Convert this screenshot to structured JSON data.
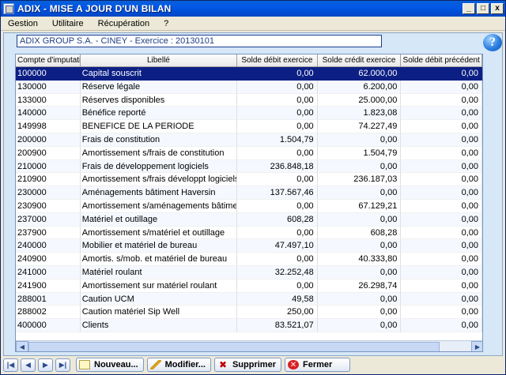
{
  "window": {
    "title": "ADIX - MISE A JOUR D'UN BILAN",
    "minimize": "_",
    "maximize": "□",
    "close": "x"
  },
  "menu": {
    "items": [
      {
        "label": "Gestion"
      },
      {
        "label": "Utilitaire"
      },
      {
        "label": "Récupération"
      },
      {
        "label": "?"
      }
    ]
  },
  "company": {
    "info": "ADIX GROUP S.A.   - CINEY - Exercice : 20130101"
  },
  "help": {
    "glyph": "?"
  },
  "table": {
    "columns": [
      "Compte d'imputation",
      "Libellé",
      "Solde débit exercice",
      "Solde crédit exercice",
      "Solde débit précédent"
    ],
    "rows": [
      [
        "100000",
        "Capital souscrit",
        "0,00",
        "62.000,00",
        "0,00"
      ],
      [
        "130000",
        "Réserve légale",
        "0,00",
        "6.200,00",
        "0,00"
      ],
      [
        "133000",
        "Réserves disponibles",
        "0,00",
        "25.000,00",
        "0,00"
      ],
      [
        "140000",
        "Bénéfice reporté",
        "0,00",
        "1.823,08",
        "0,00"
      ],
      [
        "149998",
        "BENEFICE DE LA PERIODE",
        "0,00",
        "74.227,49",
        "0,00"
      ],
      [
        "200000",
        "Frais de constitution",
        "1.504,79",
        "0,00",
        "0,00"
      ],
      [
        "200900",
        "Amortissement s/frais de constitution",
        "0,00",
        "1.504,79",
        "0,00"
      ],
      [
        "210000",
        "Frais de développement logiciels",
        "236.848,18",
        "0,00",
        "0,00"
      ],
      [
        "210900",
        "Amortissement s/frais développt logiciels",
        "0,00",
        "236.187,03",
        "0,00"
      ],
      [
        "230000",
        "Aménagements bâtiment Haversin",
        "137.567,46",
        "0,00",
        "0,00"
      ],
      [
        "230900",
        "Amortissement s/aménagements bâtime",
        "0,00",
        "67.129,21",
        "0,00"
      ],
      [
        "237000",
        "Matériel et outillage",
        "608,28",
        "0,00",
        "0,00"
      ],
      [
        "237900",
        "Amortissement s/matériel et outillage",
        "0,00",
        "608,28",
        "0,00"
      ],
      [
        "240000",
        "Mobilier et matériel de bureau",
        "47.497,10",
        "0,00",
        "0,00"
      ],
      [
        "240900",
        "Amortis. s/mob. et matériel de bureau",
        "0,00",
        "40.333,80",
        "0,00"
      ],
      [
        "241000",
        "Matériel roulant",
        "32.252,48",
        "0,00",
        "0,00"
      ],
      [
        "241900",
        "Amortissement sur matériel roulant",
        "0,00",
        "26.298,74",
        "0,00"
      ],
      [
        "288001",
        "Caution UCM",
        "49,58",
        "0,00",
        "0,00"
      ],
      [
        "288002",
        "Caution matériel Sip Well",
        "250,00",
        "0,00",
        "0,00"
      ],
      [
        "400000",
        "Clients",
        "83.521,07",
        "0,00",
        "0,00"
      ]
    ]
  },
  "toolbar": {
    "first": "|◀",
    "prev": "◀",
    "next": "▶",
    "last": "▶|",
    "new_label": "Nouveau...",
    "edit_label": "Modifier...",
    "delete_label": "Supprimer",
    "close_label": "Fermer"
  },
  "icons": {
    "app": "app-icon",
    "help": "help-icon",
    "new": "new-document-icon",
    "edit": "pencil-icon",
    "delete": "delete-x-icon",
    "close": "close-circle-icon",
    "trash": "trash-icon"
  },
  "colors": {
    "title_bar": "#0058e6",
    "selected_row": "#0c1f84",
    "client_bg": "#d6e7f8"
  }
}
